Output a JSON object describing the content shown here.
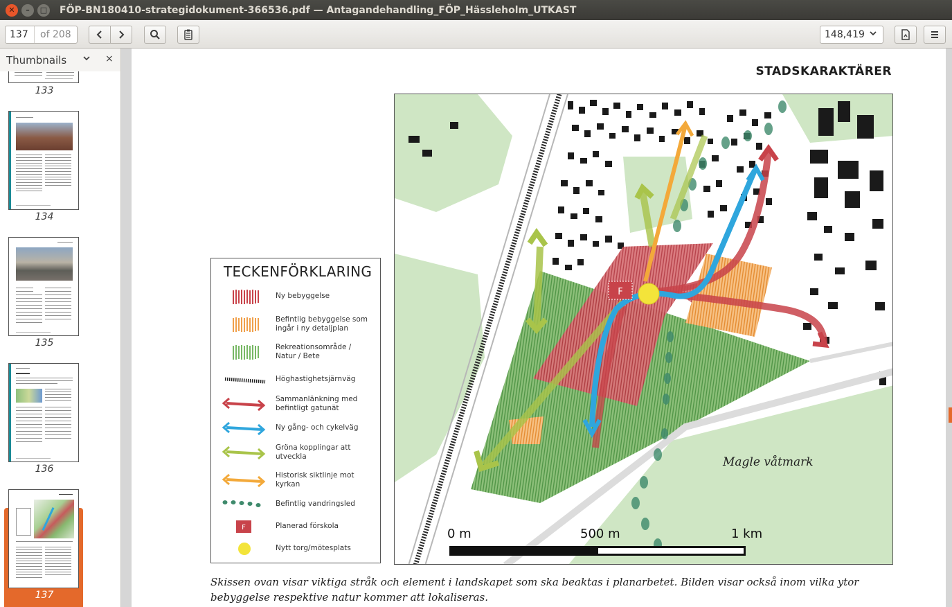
{
  "window": {
    "title": "FÖP-BN180410-strategidokument-366536.pdf — Antagandehandling_FÖP_Hässleholm_UTKAST"
  },
  "toolbar": {
    "page_current": "137",
    "page_total": "of 208",
    "zoom": "148,419",
    "icons": [
      "chevron-left-icon",
      "chevron-right-icon",
      "search-icon",
      "annotate-icon",
      "document-icon",
      "menu-icon"
    ]
  },
  "sidebar": {
    "title": "Thumbnails",
    "thumbnails": [
      {
        "label": "133"
      },
      {
        "label": "134"
      },
      {
        "label": "135"
      },
      {
        "label": "136"
      },
      {
        "label": "137"
      }
    ]
  },
  "page": {
    "heading": "STADSKARAKTÄRER",
    "legend": {
      "title": "TECKENFÖRKLARING",
      "items": [
        {
          "label": "Ny bebyggelse"
        },
        {
          "label": "Befintlig bebyggelse som\ningår i ny detaljplan"
        },
        {
          "label": "Rekreationsområde /\nNatur / Bete"
        },
        {
          "label": "Höghastighetsjärnväg"
        },
        {
          "label": "Sammanlänkning med\nbefintligt gatunät"
        },
        {
          "label": "Ny gång- och cykelväg"
        },
        {
          "label": "Gröna kopplingar att\nutveckla"
        },
        {
          "label": "Historisk siktlinje mot\nkyrkan"
        },
        {
          "label": "Befintlig vandringsled"
        },
        {
          "label": "Planerad förskola"
        },
        {
          "label": "Nytt torg/mötesplats"
        }
      ]
    },
    "map": {
      "place_label": "Magle våtmark",
      "preschool_marker": "F",
      "scale_labels": [
        "0 m",
        "500 m",
        "1 km"
      ]
    },
    "caption": "Skissen ovan visar viktiga stråk och element i landskapet som ska beaktas i planarbetet. Bilden visar också inom vilka ytor bebyggelse respektive natur kommer att lokaliseras."
  },
  "colors": {
    "accent": "#e4692b",
    "new_build_red": "#c8434a",
    "orange": "#f0a04b",
    "green": "#78b865",
    "blue": "#2fa6dd",
    "lime": "#a9c44a",
    "yellow": "#f3e43a"
  }
}
